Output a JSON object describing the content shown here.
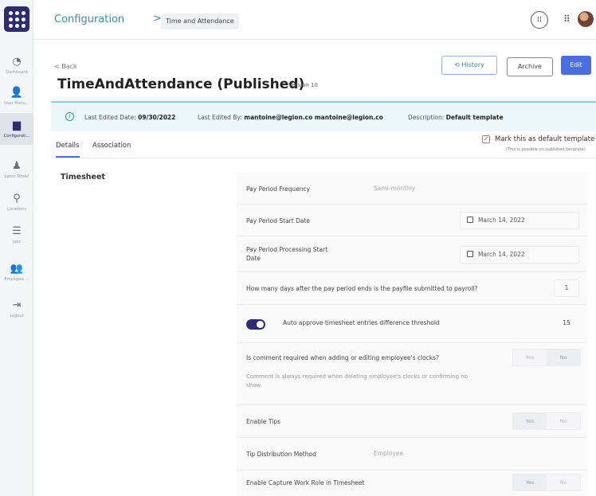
{
  "nav": {
    "items": [
      {
        "icon": "dashboard-icon",
        "label": "Dashboard"
      },
      {
        "icon": "user-management-icon",
        "label": "User Manu..."
      },
      {
        "icon": "configuration-icon",
        "label": "Configurati..."
      },
      {
        "icon": "labor-model-icon",
        "label": "Labor Model"
      },
      {
        "icon": "location-pin-icon",
        "label": "Locations"
      },
      {
        "icon": "jobs-icon",
        "label": "Jobs"
      },
      {
        "icon": "employees-icon",
        "label": "Employee ..."
      },
      {
        "icon": "logout-icon",
        "label": "Logout"
      }
    ]
  },
  "breadcrumb": {
    "root": "Configuration",
    "separator": ">",
    "current": "Time and Attendance"
  },
  "header": {
    "back": "< Back",
    "title": "TimeAndAttendance (Published)",
    "version": "Version 10",
    "history_label": "History",
    "archive_label": "Archive",
    "edit_label": "Edit"
  },
  "banner": {
    "edited_date_label": "Last Edited Date:",
    "edited_date": "09/30/2022",
    "edited_by_label": "Last Edited By:",
    "edited_by": "mantoine@legion.co mantoine@legion.co",
    "description_label": "Description:",
    "description": "Default template"
  },
  "tabs": {
    "details": "Details",
    "association": "Association"
  },
  "default_template": {
    "label": "Mark this as default template",
    "note": "(This is possible on published template)",
    "checked": true
  },
  "section": {
    "title": "Timesheet"
  },
  "settings": {
    "pay_period_frequency": {
      "label": "Pay Period Frequency",
      "value": "Semi-monthly"
    },
    "pay_period_start_date": {
      "label": "Pay Period Start Date",
      "value": "March 14, 2022"
    },
    "pay_period_processing_start": {
      "label": "Pay Period Processing Start Date",
      "value": "March 14, 2022"
    },
    "payfile_days": {
      "label": "How many days after the pay period ends is the payfile submitted to payroll?",
      "value": "1"
    },
    "auto_approve": {
      "label": "Auto approve timesheet entries difference threshold",
      "value": "15",
      "enabled": true
    },
    "comment_required": {
      "label": "Is comment required when adding or editing employee's clocks?",
      "note": "Comment is always required when deleting employee's clocks or confirming no show.",
      "yes": "Yes",
      "no": "No",
      "selected": "No"
    },
    "enable_tips": {
      "label": "Enable Tips",
      "yes": "Yes",
      "no": "No",
      "selected": "Yes"
    },
    "tip_distribution": {
      "label": "Tip Distribution Method",
      "value": "Employee"
    },
    "capture_work_role": {
      "label": "Enable Capture Work Role in Timesheet",
      "yes": "Yes",
      "no": "No",
      "selected": "Yes"
    }
  },
  "colors": {
    "accent": "#4a6ee0",
    "brand": "#2d2c73",
    "link": "#2d8fb5",
    "banner": "#eaf6f7"
  }
}
